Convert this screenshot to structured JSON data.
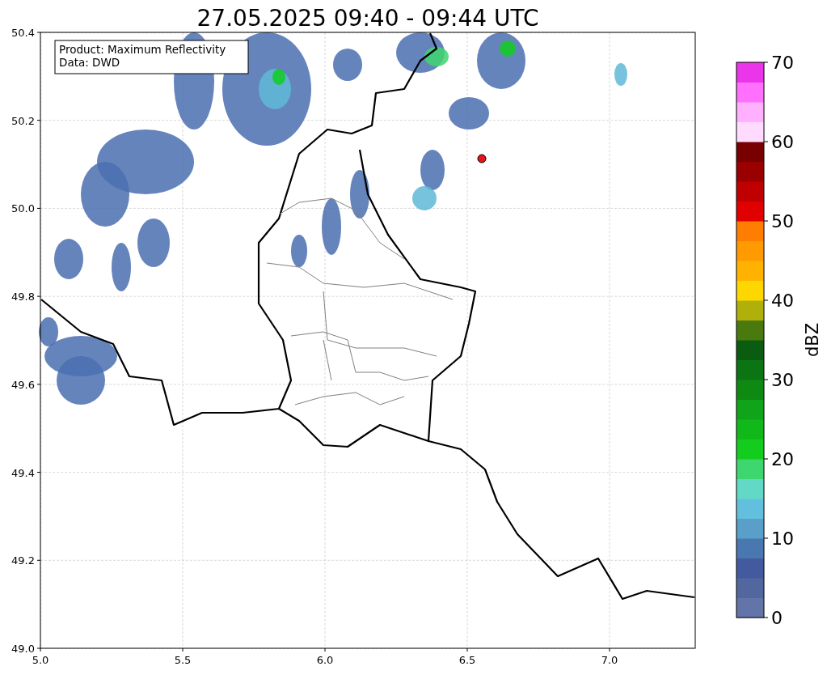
{
  "title": "27.05.2025 09:40 - 09:44 UTC",
  "info_box": {
    "lines": [
      "Product: Maximum Reflectivity",
      "Data: DWD"
    ]
  },
  "x_ticks": [
    "5.0",
    "5.5",
    "6.0",
    "6.5",
    "7.0"
  ],
  "y_ticks": [
    "50.4",
    "50.2",
    "50.0",
    "49.8",
    "49.6",
    "49.4",
    "49.2",
    "49.0"
  ],
  "colorbar": {
    "label": "dBZ",
    "ticks": [
      "70",
      "60",
      "50",
      "40",
      "30",
      "20",
      "10",
      "0"
    ],
    "bands": [
      {
        "color": "#6374a8"
      },
      {
        "color": "#53679f"
      },
      {
        "color": "#435b9e"
      },
      {
        "color": "#4978b0"
      },
      {
        "color": "#599fc9"
      },
      {
        "color": "#62c0de"
      },
      {
        "color": "#62d8c6"
      },
      {
        "color": "#3ed66e"
      },
      {
        "color": "#12cc1e"
      },
      {
        "color": "#10b81a"
      },
      {
        "color": "#0fa41a"
      },
      {
        "color": "#0e8a12"
      },
      {
        "color": "#0b7514"
      },
      {
        "color": "#0a5c10"
      },
      {
        "color": "#4a7a0e"
      },
      {
        "color": "#b0b00a"
      },
      {
        "color": "#ffd700"
      },
      {
        "color": "#ffb300"
      },
      {
        "color": "#ff9a00"
      },
      {
        "color": "#ff7d00"
      },
      {
        "color": "#e00000"
      },
      {
        "color": "#c00000"
      },
      {
        "color": "#9a0000"
      },
      {
        "color": "#780000"
      },
      {
        "color": "#ffdcff"
      },
      {
        "color": "#ffb0ff"
      },
      {
        "color": "#ff70ff"
      },
      {
        "color": "#ea35ea"
      }
    ]
  }
}
